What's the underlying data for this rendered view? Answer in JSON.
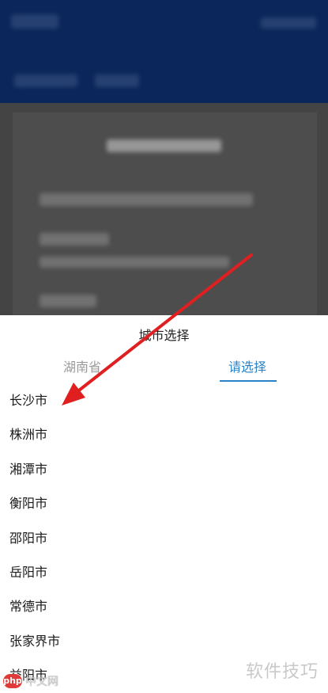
{
  "sheet": {
    "title": "城市选择",
    "tabs": [
      {
        "label": "湖南省"
      },
      {
        "label": "请选择"
      }
    ],
    "cities": [
      "长沙市",
      "株洲市",
      "湘潭市",
      "衡阳市",
      "邵阳市",
      "岳阳市",
      "常德市",
      "张家界市",
      "益阳市"
    ]
  },
  "colors": {
    "accent": "#2a83c9",
    "annotation_arrow": "#e02020"
  },
  "watermarks": {
    "right": "软件技巧",
    "left_logo": "php",
    "left_text": "中文网"
  }
}
